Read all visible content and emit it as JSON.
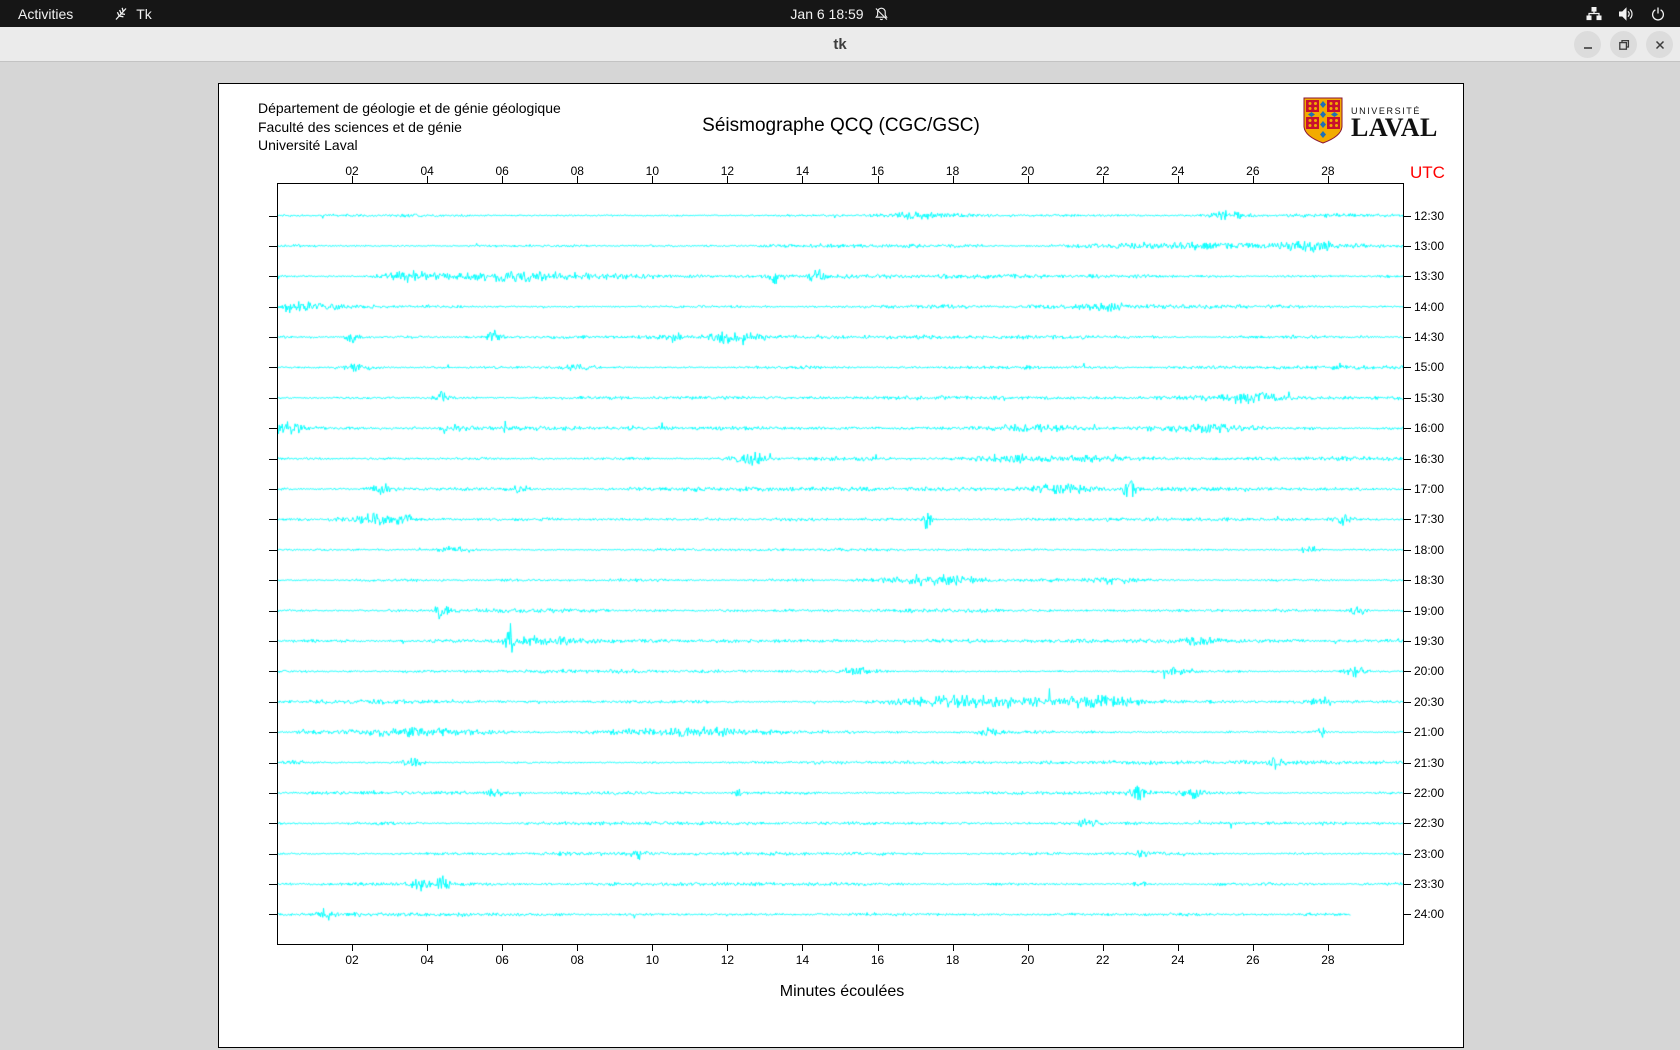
{
  "topbar": {
    "activities_label": "Activities",
    "app_name": "Tk",
    "clock": "Jan 6 18:59"
  },
  "titlebar": {
    "title": "tk"
  },
  "document": {
    "org_lines": [
      "Département de géologie et de génie géologique",
      "Faculté des sciences et de génie",
      "Université Laval"
    ],
    "logo": {
      "top": "UNIVERSITÉ",
      "bottom": "LAVAL"
    }
  },
  "chart_data": {
    "type": "line",
    "subtype": "seismogram-helicorder",
    "title": "Séismographe QCQ (CGC/GSC)",
    "xlabel": "Minutes écoulées",
    "y_axis_label": "UTC",
    "x_axis_ticks": [
      "02",
      "04",
      "06",
      "08",
      "10",
      "12",
      "14",
      "16",
      "18",
      "20",
      "22",
      "24",
      "26",
      "28"
    ],
    "x_range_minutes": [
      0,
      30
    ],
    "minutes_per_line": 30,
    "trace_color": "#00ffff",
    "utc_label_color": "#ff0000",
    "background": "#ffffff",
    "grid": false,
    "traces": [
      {
        "label": "12:30",
        "base_amp": 1.3,
        "end_minute": 30,
        "events": [
          {
            "m": 17,
            "d": 1.5,
            "a": 4
          },
          {
            "m": 25.3,
            "d": 0.8,
            "a": 4
          }
        ]
      },
      {
        "label": "13:00",
        "base_amp": 1.3,
        "end_minute": 30,
        "events": [
          {
            "m": 24,
            "d": 3,
            "a": 3.5
          },
          {
            "m": 27.5,
            "d": 1.5,
            "a": 4.5
          }
        ]
      },
      {
        "label": "13:30",
        "base_amp": 1.4,
        "end_minute": 30,
        "events": [
          {
            "m": 3.5,
            "d": 1.2,
            "a": 5
          },
          {
            "m": 6.5,
            "d": 3.5,
            "a": 5.5
          },
          {
            "m": 13.3,
            "d": 0.3,
            "a": 9
          },
          {
            "m": 14.4,
            "d": 0.3,
            "a": 10
          }
        ]
      },
      {
        "label": "14:00",
        "base_amp": 1.4,
        "end_minute": 30,
        "events": [
          {
            "m": 0.5,
            "d": 2.5,
            "a": 5.5
          },
          {
            "m": 22,
            "d": 1,
            "a": 4
          }
        ]
      },
      {
        "label": "14:30",
        "base_amp": 1.3,
        "end_minute": 30,
        "events": [
          {
            "m": 2,
            "d": 0.3,
            "a": 7
          },
          {
            "m": 5.8,
            "d": 0.4,
            "a": 6
          },
          {
            "m": 10.5,
            "d": 0.5,
            "a": 5
          },
          {
            "m": 12.2,
            "d": 1.2,
            "a": 6
          }
        ]
      },
      {
        "label": "15:00",
        "base_amp": 1.3,
        "end_minute": 30,
        "events": [
          {
            "m": 2.2,
            "d": 0.8,
            "a": 4
          },
          {
            "m": 8,
            "d": 0.8,
            "a": 4
          }
        ]
      },
      {
        "label": "15:30",
        "base_amp": 1.3,
        "end_minute": 30,
        "events": [
          {
            "m": 4.4,
            "d": 0.3,
            "a": 8
          },
          {
            "m": 25.8,
            "d": 1.5,
            "a": 5
          }
        ]
      },
      {
        "label": "16:00",
        "base_amp": 1.4,
        "end_minute": 30,
        "events": [
          {
            "m": 0.3,
            "d": 1,
            "a": 6
          },
          {
            "m": 4.8,
            "d": 0.6,
            "a": 4
          },
          {
            "m": 20,
            "d": 2,
            "a": 4
          },
          {
            "m": 24.5,
            "d": 2.5,
            "a": 5
          }
        ]
      },
      {
        "label": "16:30",
        "base_amp": 1.4,
        "end_minute": 30,
        "events": [
          {
            "m": 12.6,
            "d": 0.8,
            "a": 7
          },
          {
            "m": 19.5,
            "d": 1.5,
            "a": 4
          },
          {
            "m": 22,
            "d": 1.5,
            "a": 4
          }
        ]
      },
      {
        "label": "17:00",
        "base_amp": 1.4,
        "end_minute": 30,
        "events": [
          {
            "m": 2.8,
            "d": 0.6,
            "a": 5
          },
          {
            "m": 6.5,
            "d": 0.5,
            "a": 4
          },
          {
            "m": 21,
            "d": 1.5,
            "a": 4
          },
          {
            "m": 22.7,
            "d": 0.25,
            "a": 13
          }
        ]
      },
      {
        "label": "17:30",
        "base_amp": 1.4,
        "end_minute": 30,
        "events": [
          {
            "m": 2.6,
            "d": 0.8,
            "a": 6
          },
          {
            "m": 3.4,
            "d": 0.5,
            "a": 5
          },
          {
            "m": 17.3,
            "d": 0.25,
            "a": 11
          },
          {
            "m": 28.4,
            "d": 0.5,
            "a": 5
          }
        ]
      },
      {
        "label": "18:00",
        "base_amp": 1.2,
        "end_minute": 30,
        "events": [
          {
            "m": 4.8,
            "d": 0.8,
            "a": 4
          },
          {
            "m": 27.5,
            "d": 0.4,
            "a": 5
          }
        ]
      },
      {
        "label": "18:30",
        "base_amp": 1.3,
        "end_minute": 30,
        "events": [
          {
            "m": 17.5,
            "d": 1.8,
            "a": 6
          },
          {
            "m": 22.3,
            "d": 0.8,
            "a": 4
          }
        ]
      },
      {
        "label": "19:00",
        "base_amp": 1.3,
        "end_minute": 30,
        "events": [
          {
            "m": 4.4,
            "d": 0.25,
            "a": 14
          },
          {
            "m": 28.8,
            "d": 0.4,
            "a": 5
          }
        ]
      },
      {
        "label": "19:30",
        "base_amp": 1.3,
        "end_minute": 30,
        "events": [
          {
            "m": 6.2,
            "d": 0.18,
            "a": 25
          },
          {
            "m": 7,
            "d": 1.5,
            "a": 5
          },
          {
            "m": 24.5,
            "d": 0.8,
            "a": 4
          }
        ]
      },
      {
        "label": "20:00",
        "base_amp": 1.4,
        "end_minute": 30,
        "events": [
          {
            "m": 15.5,
            "d": 1,
            "a": 4
          },
          {
            "m": 24,
            "d": 0.8,
            "a": 4
          },
          {
            "m": 28.7,
            "d": 0.4,
            "a": 7
          }
        ]
      },
      {
        "label": "20:30",
        "base_amp": 1.4,
        "end_minute": 30,
        "events": [
          {
            "m": 18.5,
            "d": 3.5,
            "a": 7
          },
          {
            "m": 22,
            "d": 2,
            "a": 6
          },
          {
            "m": 27.8,
            "d": 0.5,
            "a": 5
          }
        ]
      },
      {
        "label": "21:00",
        "base_amp": 1.4,
        "end_minute": 30,
        "events": [
          {
            "m": 3.5,
            "d": 3,
            "a": 5
          },
          {
            "m": 11,
            "d": 4,
            "a": 4
          },
          {
            "m": 19,
            "d": 0.5,
            "a": 4
          },
          {
            "m": 27.8,
            "d": 0.3,
            "a": 6
          }
        ]
      },
      {
        "label": "21:30",
        "base_amp": 1.3,
        "end_minute": 30,
        "events": [
          {
            "m": 0.5,
            "d": 0.4,
            "a": 4
          },
          {
            "m": 3.6,
            "d": 0.5,
            "a": 4
          },
          {
            "m": 26.6,
            "d": 0.3,
            "a": 7
          }
        ]
      },
      {
        "label": "22:00",
        "base_amp": 1.3,
        "end_minute": 30,
        "events": [
          {
            "m": 5.8,
            "d": 0.3,
            "a": 6
          },
          {
            "m": 12.3,
            "d": 0.3,
            "a": 5
          },
          {
            "m": 23,
            "d": 0.4,
            "a": 6
          },
          {
            "m": 24.4,
            "d": 0.5,
            "a": 6
          }
        ]
      },
      {
        "label": "22:30",
        "base_amp": 1.2,
        "end_minute": 30,
        "events": [
          {
            "m": 21.6,
            "d": 0.5,
            "a": 4
          }
        ]
      },
      {
        "label": "23:00",
        "base_amp": 1.2,
        "end_minute": 30,
        "events": [
          {
            "m": 9.6,
            "d": 0.3,
            "a": 5
          },
          {
            "m": 23,
            "d": 0.3,
            "a": 4
          }
        ]
      },
      {
        "label": "23:30",
        "base_amp": 1.2,
        "end_minute": 30,
        "events": [
          {
            "m": 3.8,
            "d": 0.4,
            "a": 6
          },
          {
            "m": 4.4,
            "d": 0.3,
            "a": 7
          },
          {
            "m": 23,
            "d": 0.3,
            "a": 5
          }
        ]
      },
      {
        "label": "24:00",
        "base_amp": 1.7,
        "end_minute": 28.6,
        "events": [
          {
            "m": 1.3,
            "d": 0.3,
            "a": 6
          }
        ]
      }
    ]
  }
}
